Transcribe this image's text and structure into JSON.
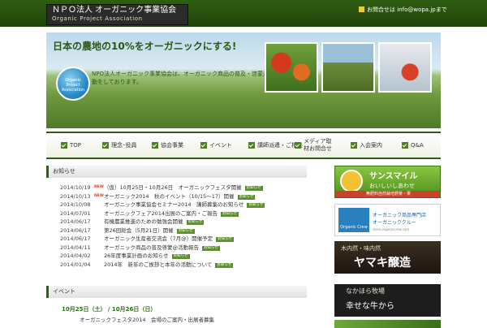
{
  "header": {
    "logo_title": "ＮＰＯ法人 オーガニック事業協会",
    "logo_subtitle": "Organic Project Association",
    "contact": "お問合せは info@wopa.jpまで"
  },
  "hero": {
    "headline": "日本の農地の10%をオーガニックにする!",
    "description": "NPO法人オーガニック事業協会は、オーガニック商品の普及・啓蒙活動をしております。",
    "globe_label": "Organic Project Association"
  },
  "nav": {
    "items": [
      {
        "label": "TOP"
      },
      {
        "label": "理念･役員"
      },
      {
        "label": "協会事業"
      },
      {
        "label": "イベント"
      },
      {
        "label": "講師派遣・ご相談"
      },
      {
        "label": "メディア取材お問合せ"
      },
      {
        "label": "入会案内"
      },
      {
        "label": "Q&A"
      }
    ]
  },
  "news": {
    "heading": "お知らせ",
    "new_label": "NEW",
    "tag_label": "お知らせ",
    "rows": [
      {
        "date": "2014/10/19",
        "new": true,
        "title": "（仮）10月25日・10月26日　オーガニックフェスタ開催"
      },
      {
        "date": "2014/10/13",
        "new": true,
        "title": "オーガニック2014　秋のイベント（10/15～17）開催"
      },
      {
        "date": "2014/10/08",
        "new": false,
        "title": "オーガニック事業協会セミナー2014　講師募集のお知らせ"
      },
      {
        "date": "2014/07/01",
        "new": false,
        "title": "オーガニックフェア2014出展のご案内・ご報告"
      },
      {
        "date": "2014/06/17",
        "new": false,
        "title": "有機農業推進のための勉強会開催"
      },
      {
        "date": "2014/06/17",
        "new": false,
        "title": "第26回総会（5月21日）開催"
      },
      {
        "date": "2014/06/17",
        "new": false,
        "title": "オーガニック生産者交流会（7月@）開催予定"
      },
      {
        "date": "2014/04/11",
        "new": false,
        "title": "オーガニック商品の普及啓蒙@活動報告"
      },
      {
        "date": "2014/04/02",
        "new": false,
        "title": "26年度事業計画のお知らせ"
      },
      {
        "date": "2014/01/04",
        "new": false,
        "title": "2014年　新年のご挨拶と本年の活動について"
      }
    ]
  },
  "events": {
    "heading": "イベント",
    "date_line": "10月25日（土） / 10月26日（日）",
    "desc": "オーガニックフェスタ2014　会場のご案内・出展者募集"
  },
  "banners": {
    "b1_title": "サンスマイル",
    "b1_sub": "おいしいしあわせ",
    "b1_bar": "無肥料自然栽培野菜・果",
    "b2_logo": "Organic Crew",
    "b2_title": "オーガニック商品専門店",
    "b2_sub": "オーガニッククルー",
    "b2_url": "store.organiccrew.com",
    "b3_sub": "木内然・味内然",
    "b3_title": "ヤマキ醸造",
    "b4_sub": "なかほら牧場",
    "b4_title": "幸せな牛から"
  }
}
